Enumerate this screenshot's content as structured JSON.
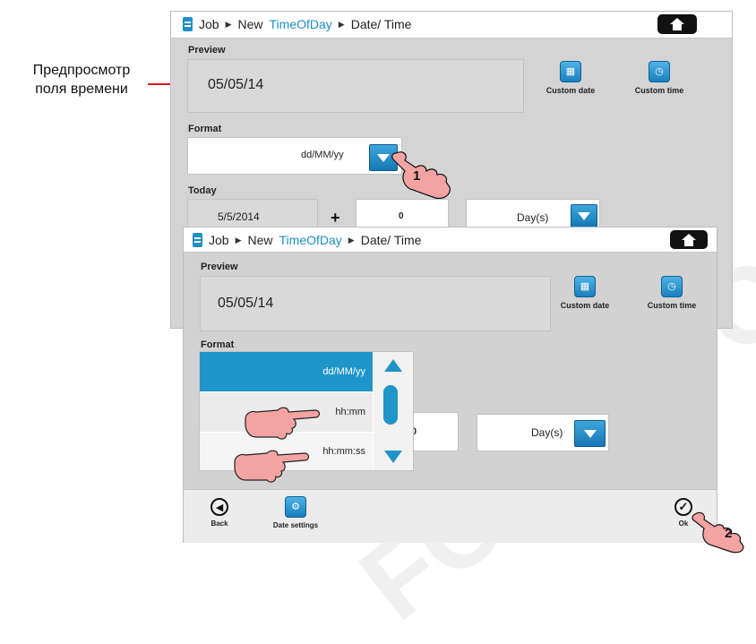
{
  "annotation": {
    "line1": "Предпросмотр",
    "line2": "поля времени"
  },
  "callouts": {
    "one": "1",
    "two": "2"
  },
  "screen1": {
    "breadcrumb": {
      "job": "Job",
      "new": "New",
      "module": "TimeOfDay",
      "page": "Date/ Time"
    },
    "preview_label": "Preview",
    "preview_value": "05/05/14",
    "format_label": "Format",
    "format_value": "dd/MM/yy",
    "today_label": "Today",
    "today_value": "5/5/2014",
    "plus": "+",
    "offset_value": "0",
    "unit_value": "Day(s)",
    "custom_date": "Custom date",
    "custom_time": "Custom time"
  },
  "screen2": {
    "breadcrumb": {
      "job": "Job",
      "new": "New",
      "module": "TimeOfDay",
      "page": "Date/ Time"
    },
    "preview_label": "Preview",
    "preview_value": "05/05/14",
    "format_label": "Format",
    "format_options": [
      "dd/MM/yy",
      "hh:mm",
      "hh:mm:ss"
    ],
    "selected_index": 0,
    "offset_partial": "0",
    "unit_value": "Day(s)",
    "custom_date": "Custom date",
    "custom_time": "Custom time",
    "back_label": "Back",
    "date_settings_label": "Date settings",
    "ok_label": "Ok"
  },
  "watermark": "FOR INFORMATION",
  "colors": {
    "accent": "#1f95c9",
    "panel": "#d4d4d4",
    "hand": "#f4a3a3",
    "arrow": "#e0191e"
  }
}
